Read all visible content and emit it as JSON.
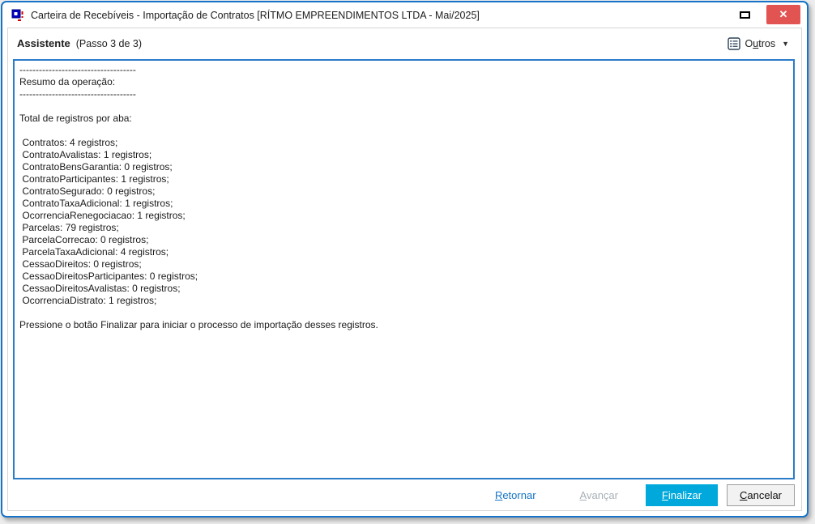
{
  "window": {
    "title": "Carteira de Recebíveis - Importação de Contratos [RÍTMO EMPREENDIMENTOS LTDA - Mai/2025]",
    "close_glyph": "✕"
  },
  "header": {
    "title": "Assistente",
    "step": "(Passo 3 de 3)",
    "outros": {
      "label": "Outros",
      "underline": "u"
    }
  },
  "summary": {
    "divider": "------------------------------------",
    "heading": "Resumo da operação:",
    "section": "Total de registros por aba:",
    "record_word": "registros;",
    "tabs": [
      {
        "name": "Contratos",
        "count": 4
      },
      {
        "name": "ContratoAvalistas",
        "count": 1
      },
      {
        "name": "ContratoBensGarantia",
        "count": 0
      },
      {
        "name": "ContratoParticipantes",
        "count": 1
      },
      {
        "name": "ContratoSegurado",
        "count": 0
      },
      {
        "name": "ContratoTaxaAdicional",
        "count": 1
      },
      {
        "name": "OcorrenciaRenegociacao",
        "count": 1
      },
      {
        "name": "Parcelas",
        "count": 79
      },
      {
        "name": "ParcelaCorrecao",
        "count": 0
      },
      {
        "name": "ParcelaTaxaAdicional",
        "count": 4
      },
      {
        "name": "CessaoDireitos",
        "count": 0
      },
      {
        "name": "CessaoDireitosParticipantes",
        "count": 0
      },
      {
        "name": "CessaoDireitosAvalistas",
        "count": 0
      },
      {
        "name": "OcorrenciaDistrato",
        "count": 1
      }
    ],
    "footer": "Pressione o botão Finalizar para iniciar o processo de importação desses registros."
  },
  "buttons": {
    "retornar": {
      "label": "Retornar",
      "underline": "R"
    },
    "avancar": {
      "label": "Avançar",
      "underline": "A"
    },
    "finalizar": {
      "label": "Finalizar",
      "underline": "F"
    },
    "cancelar": {
      "label": "Cancelar",
      "underline": "C"
    }
  },
  "colors": {
    "window_border": "#1673C7",
    "memo_border": "#2B7CC9",
    "finalizar_bg": "#00A8DC",
    "close_bg": "#E15451",
    "disabled_text": "#A8B0B7",
    "link_text": "#1673C7"
  }
}
